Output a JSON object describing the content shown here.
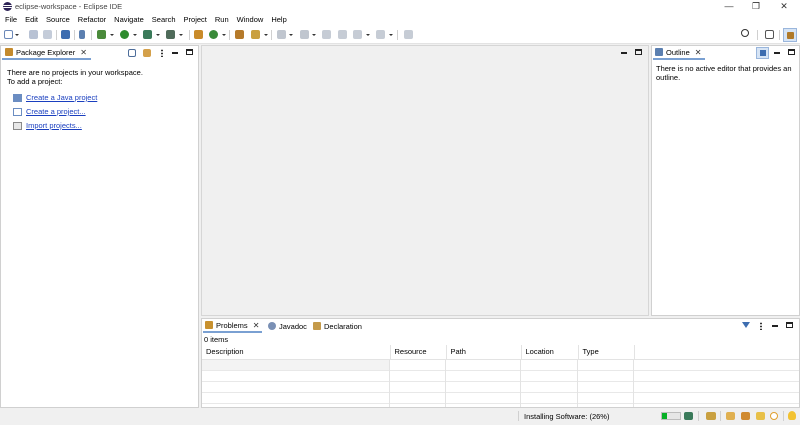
{
  "window": {
    "title": "eclipse-workspace - Eclipse IDE",
    "minimize": "—",
    "restore": "❐",
    "close": "✕"
  },
  "menu": [
    "File",
    "Edit",
    "Source",
    "Refactor",
    "Navigate",
    "Search",
    "Project",
    "Run",
    "Window",
    "Help"
  ],
  "package_explorer": {
    "tab_label": "Package Explorer",
    "empty_line1": "There are no projects in your workspace.",
    "empty_line2": "To add a project:",
    "links": [
      "Create a Java project",
      "Create a project...",
      "Import projects..."
    ]
  },
  "outline": {
    "tab_label": "Outline",
    "message": "There is no active editor that provides an outline."
  },
  "bottom": {
    "tabs": [
      "Problems",
      "Javadoc",
      "Declaration"
    ],
    "item_count": "0 items",
    "columns": [
      "Description",
      "Resource",
      "Path",
      "Location",
      "Type"
    ]
  },
  "status": {
    "text": "Installing Software: (26%)",
    "progress": 0.26
  },
  "colors": {
    "accent_tab": "#7aa0d2",
    "link": "#1a3fbf",
    "progress": "#06b025"
  }
}
